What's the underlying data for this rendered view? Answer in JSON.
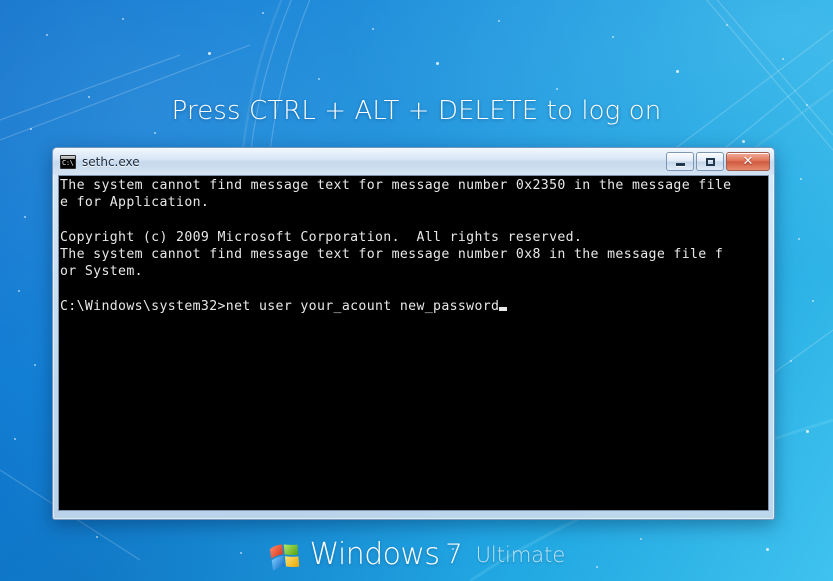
{
  "screen": {
    "logon_prompt": "Press CTRL + ALT + DELETE to log on"
  },
  "colors": {
    "background_top_left": "#0f72cc",
    "background_bottom_right": "#3fc2ee",
    "console_background": "#000000",
    "console_text": "#e8e8e8",
    "close_button": "#cf5a3e",
    "branding_text": "#ffffff"
  },
  "window": {
    "title": "sethc.exe",
    "icon": "command-prompt-icon",
    "buttons": {
      "minimize": "minimize-button",
      "minimize_glyph": "",
      "maximize": "maximize-button",
      "maximize_glyph": "",
      "close": "close-button",
      "close_glyph": "✕"
    },
    "console": {
      "lines": [
        "The system cannot find message text for message number 0x2350 in the message file",
        "e for Application.",
        "",
        "Copyright (c) 2009 Microsoft Corporation.  All rights reserved.",
        "The system cannot find message text for message number 0x8 in the message file f",
        "or System.",
        "",
        "C:\\Windows\\system32>net user your_acount new_password"
      ],
      "cursor": "block-cursor"
    }
  },
  "branding": {
    "logo": "windows-flag-logo",
    "product": "Windows",
    "version": "7",
    "edition": "Ultimate"
  }
}
